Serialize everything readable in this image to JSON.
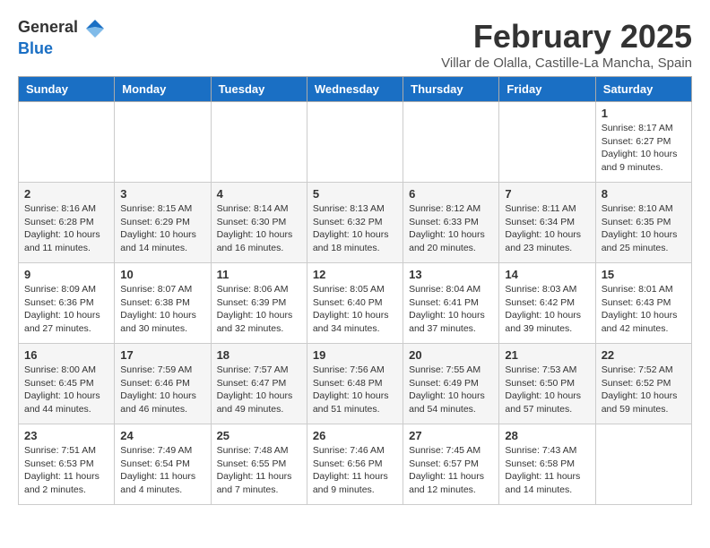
{
  "header": {
    "logo_general": "General",
    "logo_blue": "Blue",
    "title": "February 2025",
    "subtitle": "Villar de Olalla, Castille-La Mancha, Spain"
  },
  "calendar": {
    "days_of_week": [
      "Sunday",
      "Monday",
      "Tuesday",
      "Wednesday",
      "Thursday",
      "Friday",
      "Saturday"
    ],
    "weeks": [
      [
        {
          "day": "",
          "info": ""
        },
        {
          "day": "",
          "info": ""
        },
        {
          "day": "",
          "info": ""
        },
        {
          "day": "",
          "info": ""
        },
        {
          "day": "",
          "info": ""
        },
        {
          "day": "",
          "info": ""
        },
        {
          "day": "1",
          "info": "Sunrise: 8:17 AM\nSunset: 6:27 PM\nDaylight: 10 hours\nand 9 minutes."
        }
      ],
      [
        {
          "day": "2",
          "info": "Sunrise: 8:16 AM\nSunset: 6:28 PM\nDaylight: 10 hours\nand 11 minutes."
        },
        {
          "day": "3",
          "info": "Sunrise: 8:15 AM\nSunset: 6:29 PM\nDaylight: 10 hours\nand 14 minutes."
        },
        {
          "day": "4",
          "info": "Sunrise: 8:14 AM\nSunset: 6:30 PM\nDaylight: 10 hours\nand 16 minutes."
        },
        {
          "day": "5",
          "info": "Sunrise: 8:13 AM\nSunset: 6:32 PM\nDaylight: 10 hours\nand 18 minutes."
        },
        {
          "day": "6",
          "info": "Sunrise: 8:12 AM\nSunset: 6:33 PM\nDaylight: 10 hours\nand 20 minutes."
        },
        {
          "day": "7",
          "info": "Sunrise: 8:11 AM\nSunset: 6:34 PM\nDaylight: 10 hours\nand 23 minutes."
        },
        {
          "day": "8",
          "info": "Sunrise: 8:10 AM\nSunset: 6:35 PM\nDaylight: 10 hours\nand 25 minutes."
        }
      ],
      [
        {
          "day": "9",
          "info": "Sunrise: 8:09 AM\nSunset: 6:36 PM\nDaylight: 10 hours\nand 27 minutes."
        },
        {
          "day": "10",
          "info": "Sunrise: 8:07 AM\nSunset: 6:38 PM\nDaylight: 10 hours\nand 30 minutes."
        },
        {
          "day": "11",
          "info": "Sunrise: 8:06 AM\nSunset: 6:39 PM\nDaylight: 10 hours\nand 32 minutes."
        },
        {
          "day": "12",
          "info": "Sunrise: 8:05 AM\nSunset: 6:40 PM\nDaylight: 10 hours\nand 34 minutes."
        },
        {
          "day": "13",
          "info": "Sunrise: 8:04 AM\nSunset: 6:41 PM\nDaylight: 10 hours\nand 37 minutes."
        },
        {
          "day": "14",
          "info": "Sunrise: 8:03 AM\nSunset: 6:42 PM\nDaylight: 10 hours\nand 39 minutes."
        },
        {
          "day": "15",
          "info": "Sunrise: 8:01 AM\nSunset: 6:43 PM\nDaylight: 10 hours\nand 42 minutes."
        }
      ],
      [
        {
          "day": "16",
          "info": "Sunrise: 8:00 AM\nSunset: 6:45 PM\nDaylight: 10 hours\nand 44 minutes."
        },
        {
          "day": "17",
          "info": "Sunrise: 7:59 AM\nSunset: 6:46 PM\nDaylight: 10 hours\nand 46 minutes."
        },
        {
          "day": "18",
          "info": "Sunrise: 7:57 AM\nSunset: 6:47 PM\nDaylight: 10 hours\nand 49 minutes."
        },
        {
          "day": "19",
          "info": "Sunrise: 7:56 AM\nSunset: 6:48 PM\nDaylight: 10 hours\nand 51 minutes."
        },
        {
          "day": "20",
          "info": "Sunrise: 7:55 AM\nSunset: 6:49 PM\nDaylight: 10 hours\nand 54 minutes."
        },
        {
          "day": "21",
          "info": "Sunrise: 7:53 AM\nSunset: 6:50 PM\nDaylight: 10 hours\nand 57 minutes."
        },
        {
          "day": "22",
          "info": "Sunrise: 7:52 AM\nSunset: 6:52 PM\nDaylight: 10 hours\nand 59 minutes."
        }
      ],
      [
        {
          "day": "23",
          "info": "Sunrise: 7:51 AM\nSunset: 6:53 PM\nDaylight: 11 hours\nand 2 minutes."
        },
        {
          "day": "24",
          "info": "Sunrise: 7:49 AM\nSunset: 6:54 PM\nDaylight: 11 hours\nand 4 minutes."
        },
        {
          "day": "25",
          "info": "Sunrise: 7:48 AM\nSunset: 6:55 PM\nDaylight: 11 hours\nand 7 minutes."
        },
        {
          "day": "26",
          "info": "Sunrise: 7:46 AM\nSunset: 6:56 PM\nDaylight: 11 hours\nand 9 minutes."
        },
        {
          "day": "27",
          "info": "Sunrise: 7:45 AM\nSunset: 6:57 PM\nDaylight: 11 hours\nand 12 minutes."
        },
        {
          "day": "28",
          "info": "Sunrise: 7:43 AM\nSunset: 6:58 PM\nDaylight: 11 hours\nand 14 minutes."
        },
        {
          "day": "",
          "info": ""
        }
      ]
    ]
  }
}
